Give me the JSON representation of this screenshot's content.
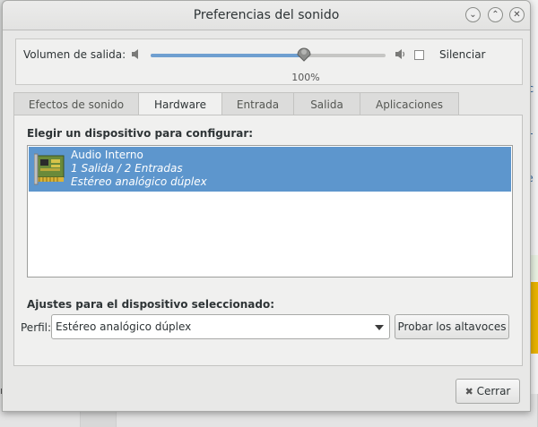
{
  "window": {
    "title": "Preferencias del sonido",
    "controls": [
      "minimize-icon",
      "maximize-icon",
      "close-icon"
    ]
  },
  "volume": {
    "label": "Volumen de salida:",
    "level_percent": 100,
    "level_text": "100%",
    "mute_label": "Silenciar",
    "muted": false
  },
  "tabs": [
    {
      "label": "Efectos de sonido",
      "active": false
    },
    {
      "label": "Hardware",
      "active": true
    },
    {
      "label": "Entrada",
      "active": false
    },
    {
      "label": "Salida",
      "active": false
    },
    {
      "label": "Aplicaciones",
      "active": false
    }
  ],
  "hardware": {
    "choose_label": "Elegir un dispositivo para configurar:",
    "devices": [
      {
        "name": "Audio Interno",
        "ports": "1 Salida / 2 Entradas",
        "profile": "Estéreo analógico dúplex",
        "selected": true
      }
    ],
    "settings_label": "Ajustes para el dispositivo seleccionado:",
    "profile_label": "Perfil:",
    "profile_value": "Estéreo analógico dúplex",
    "test_button": "Probar los altavoces"
  },
  "footer": {
    "close_label": "Cerrar"
  },
  "colors": {
    "selection": "#5d96cd",
    "slider_fill": "#6f9fd0",
    "background_accent": "#e9b300"
  }
}
